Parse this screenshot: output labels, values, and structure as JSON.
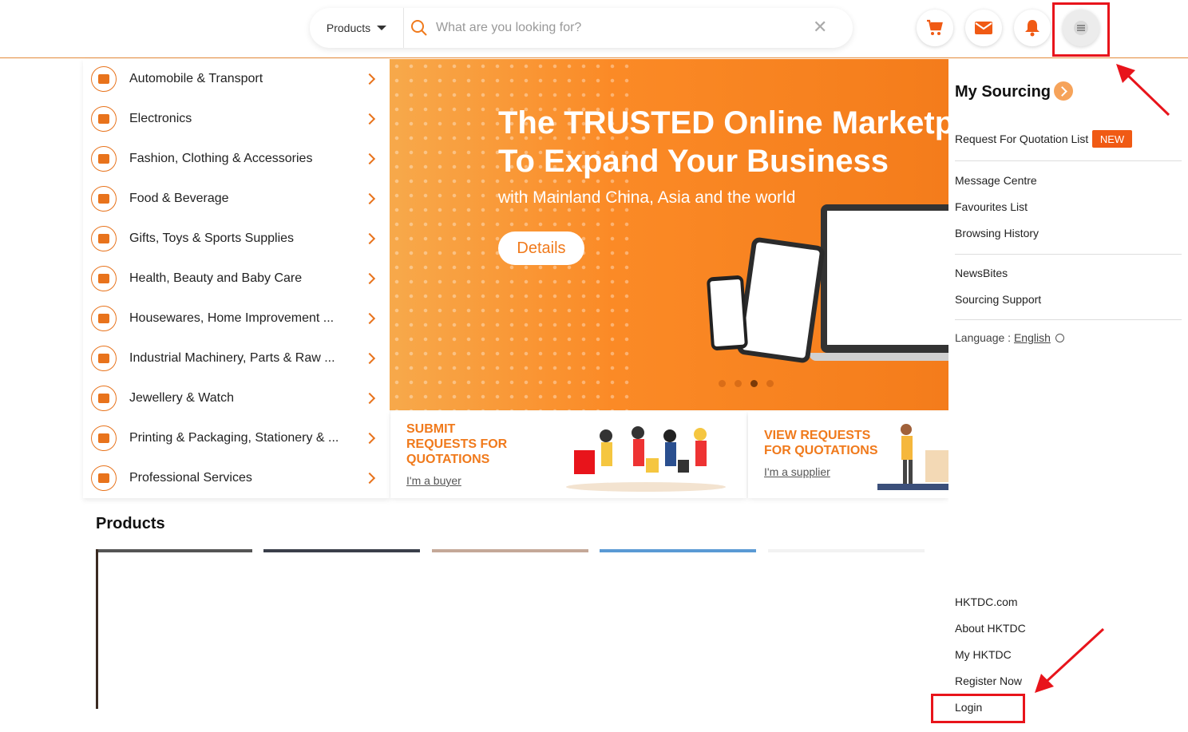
{
  "header": {
    "product_select": "Products",
    "search_placeholder": "What are you looking for?",
    "clear_glyph": "✕"
  },
  "categories": [
    {
      "label": "Automobile & Transport"
    },
    {
      "label": "Electronics"
    },
    {
      "label": "Fashion, Clothing & Accessories"
    },
    {
      "label": "Food & Beverage"
    },
    {
      "label": "Gifts, Toys & Sports Supplies"
    },
    {
      "label": "Health, Beauty and Baby Care"
    },
    {
      "label": "Housewares, Home Improvement ..."
    },
    {
      "label": "Industrial Machinery, Parts & Raw ..."
    },
    {
      "label": "Jewellery & Watch"
    },
    {
      "label": "Printing & Packaging, Stationery & ..."
    },
    {
      "label": "Professional Services"
    }
  ],
  "banner": {
    "title_line1": "The TRUSTED Online Marketplace",
    "title_line2": "To Expand Your Business",
    "subtitle": "with Mainland China, Asia and the world",
    "button": "Details"
  },
  "tiles": {
    "submit_title_1": "SUBMIT",
    "submit_title_2": "REQUESTS FOR",
    "submit_title_3": "QUOTATIONS",
    "submit_link": "I'm a buyer",
    "view_title_1": "VIEW REQUESTS",
    "view_title_2": "FOR QUOTATIONS",
    "view_link": "I'm a supplier"
  },
  "products": {
    "title": "Products"
  },
  "dropdown": {
    "title": "My Sourcing",
    "rfq_list": "Request For Quotation List",
    "new_badge": "NEW",
    "message_centre": "Message Centre",
    "favourites": "Favourites List",
    "history": "Browsing History",
    "newsbites": "NewsBites",
    "support": "Sourcing Support",
    "language_label": "Language : ",
    "language_value": "English",
    "hktdc_com": "HKTDC.com",
    "about": "About HKTDC",
    "my_hktdc": "My HKTDC",
    "register": "Register Now",
    "login": "Login"
  },
  "colors": {
    "accent": "#f07a1c",
    "highlight": "#e8141b"
  }
}
